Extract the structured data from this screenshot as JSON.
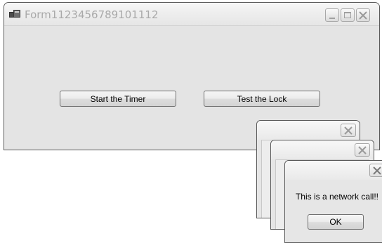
{
  "main_window": {
    "title": "Form1123456789101112",
    "buttons": {
      "start_timer": "Start the Timer",
      "test_lock": "Test the Lock"
    }
  },
  "dialog": {
    "message": "This is a network call!!",
    "ok_label": "OK"
  },
  "icons": {
    "app": "app-icon",
    "minimize": "minimize-icon",
    "maximize": "maximize-icon",
    "close": "close-icon"
  },
  "colors": {
    "title_text": "#a9a9a9",
    "window_bg": "#e4e4e4",
    "border": "#5d5d5d"
  }
}
